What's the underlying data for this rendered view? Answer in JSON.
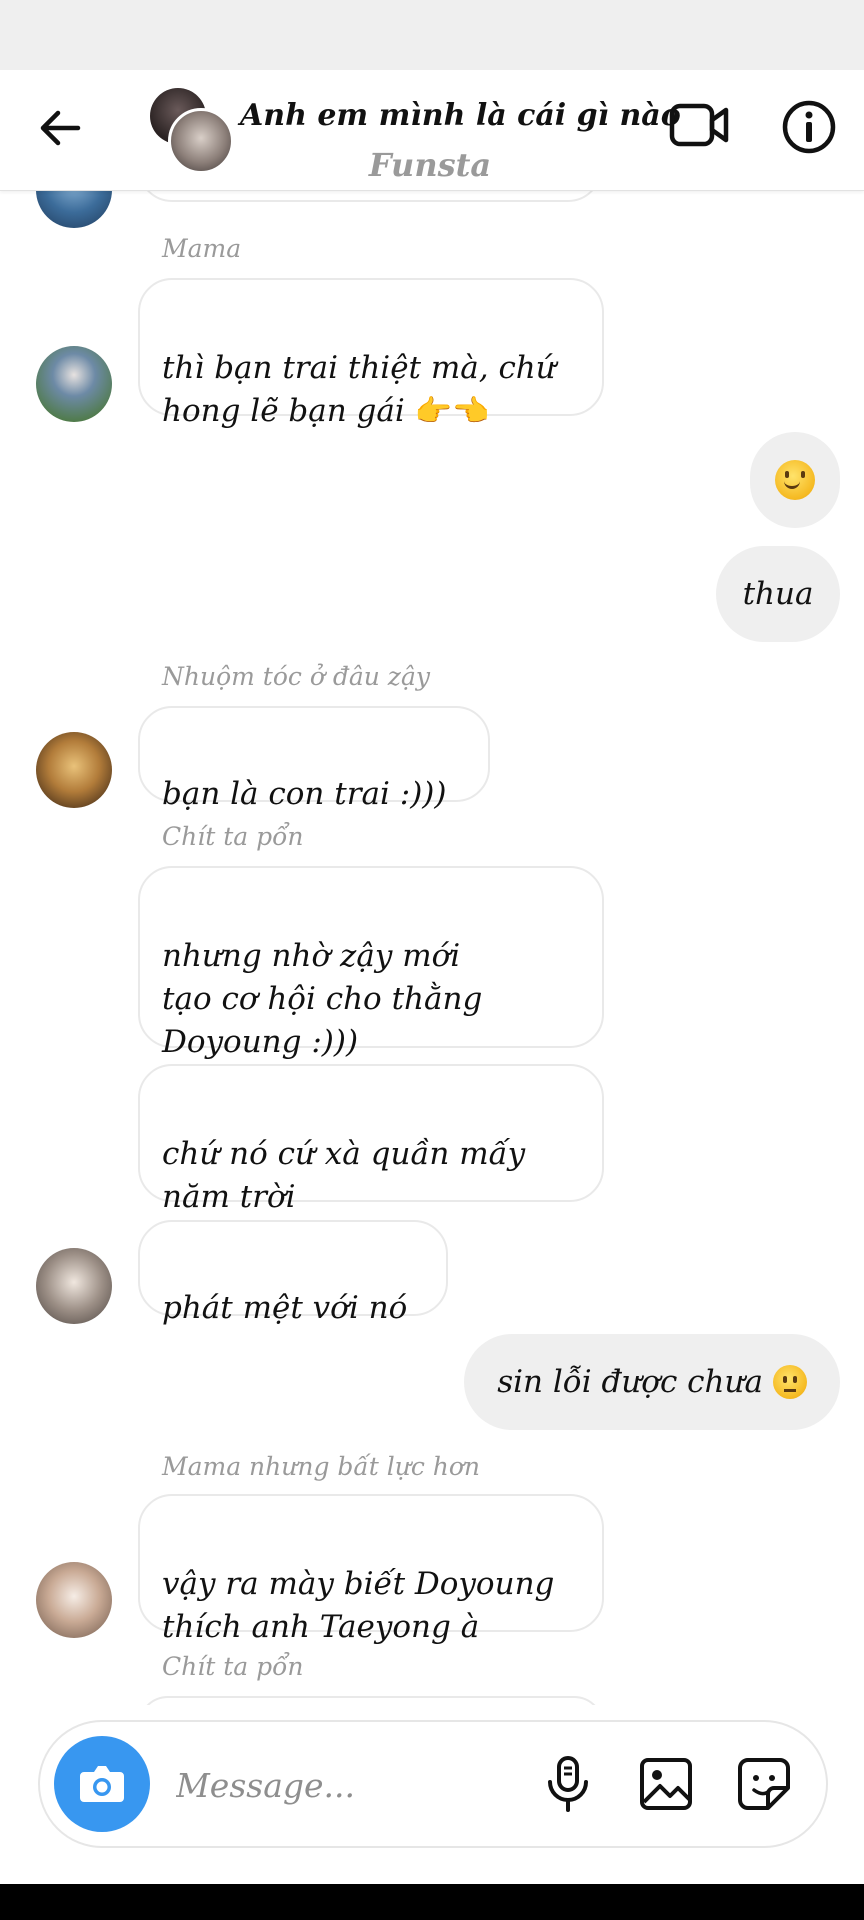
{
  "header": {
    "title": "Anh em mình là cái gì nào",
    "subtitle": "Funsta"
  },
  "messages": [
    {
      "sender": "Mama",
      "text": "thì bạn trai thiệt mà, chứ\nhong lẽ bạn gái"
    },
    {
      "text": "thua"
    },
    {
      "sender": "Nhuộm tóc ở đâu zậy",
      "text": "bạn là con trai :)))"
    },
    {
      "sender": "Chít ta pổn",
      "text": "nhưng nhờ zậy mới\ntạo cơ hội cho thằng\nDoyoung :)))"
    },
    {
      "text": "chứ nó cứ xà quần mấy\nnăm trời"
    },
    {
      "text": "phát mệt với nó"
    },
    {
      "text": "sin lỗi được chưa"
    },
    {
      "sender": "Mama nhưng bất lực hơn",
      "text": "vậy ra mày biết Doyoung\nthích anh Taeyong à"
    },
    {
      "sender": "Chít ta pổn"
    }
  ],
  "composer": {
    "placeholder": "Message..."
  },
  "emoji": {
    "pointing": "👉👈",
    "smile": "smiling-face-emoji",
    "pensive": "pensive-face-emoji"
  },
  "colors": {
    "accent": "#3897f0",
    "bubble_out": "#efefef",
    "sender_gray": "#9a9a9a"
  }
}
